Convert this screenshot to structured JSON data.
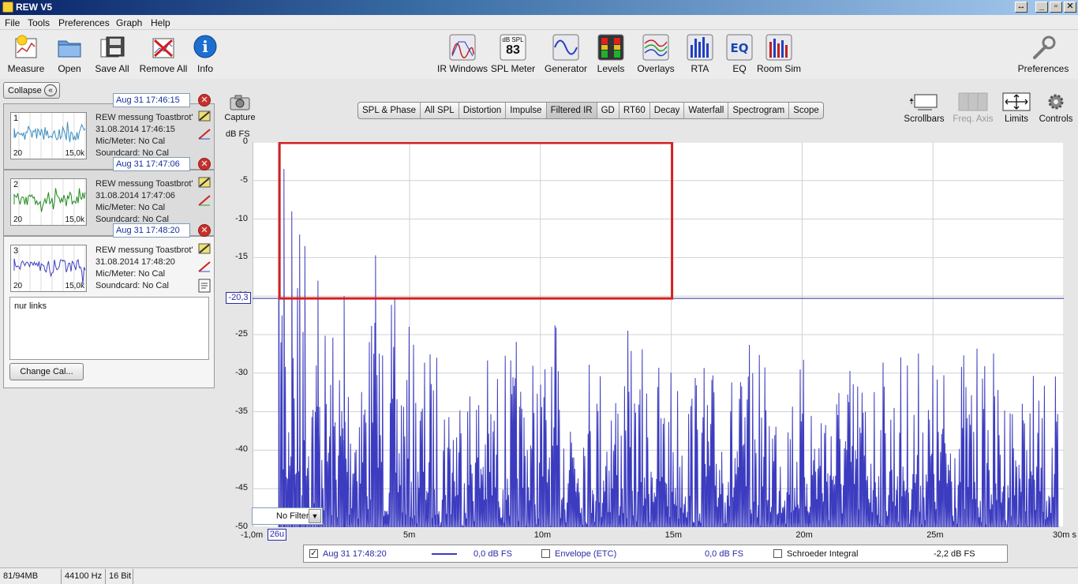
{
  "window": {
    "title": "REW V5"
  },
  "menu": [
    "File",
    "Tools",
    "Preferences",
    "Graph",
    "Help"
  ],
  "toolbar_left": [
    {
      "label": "Measure",
      "icon": "measure-icon"
    },
    {
      "label": "Open",
      "icon": "folder-icon"
    },
    {
      "label": "Save All",
      "icon": "save-icon"
    },
    {
      "label": "Remove All",
      "icon": "remove-icon"
    },
    {
      "label": "Info",
      "icon": "info-icon"
    }
  ],
  "toolbar_center": [
    {
      "label": "IR Windows",
      "icon": "ir-windows-icon"
    },
    {
      "label": "SPL Meter",
      "icon": "spl-meter-icon",
      "badge_top": "dB SPL",
      "badge_value": "83"
    },
    {
      "label": "Generator",
      "icon": "generator-icon"
    },
    {
      "label": "Levels",
      "icon": "levels-icon"
    },
    {
      "label": "Overlays",
      "icon": "overlays-icon"
    },
    {
      "label": "RTA",
      "icon": "rta-icon"
    },
    {
      "label": "EQ",
      "icon": "eq-icon"
    },
    {
      "label": "Room Sim",
      "icon": "room-sim-icon"
    }
  ],
  "toolbar_right": {
    "label": "Preferences",
    "icon": "wrench-icon"
  },
  "left_panel": {
    "collapse_label": "Collapse",
    "measurements": [
      {
        "num": "1",
        "date": "Aug 31 17:46:15",
        "name": "REW messung Toastbrot'",
        "timestamp": "31.08.2014 17:46:15",
        "mic": "Mic/Meter: No Cal",
        "soundcard": "Soundcard: No Cal",
        "range_lo": "20",
        "range_hi": "15,0k",
        "color": "#3b8fbf"
      },
      {
        "num": "2",
        "date": "Aug 31 17:47:06",
        "name": "REW messung Toastbrot'",
        "timestamp": "31.08.2014 17:47:06",
        "mic": "Mic/Meter: No Cal",
        "soundcard": "Soundcard: No Cal",
        "range_lo": "20",
        "range_hi": "15,0k",
        "color": "#1e8a1e"
      },
      {
        "num": "3",
        "date": "Aug 31 17:48:20",
        "name": "REW messung Toastbrot'",
        "timestamp": "31.08.2014 17:48:20",
        "mic": "Mic/Meter: No Cal",
        "soundcard": "Soundcard: No Cal",
        "range_lo": "20",
        "range_hi": "15,0k",
        "color": "#3f3fbf"
      }
    ],
    "notes": "nur links",
    "change_cal_label": "Change Cal..."
  },
  "graph": {
    "capture_label": "Capture",
    "tabs": [
      "SPL & Phase",
      "All SPL",
      "Distortion",
      "Impulse",
      "Filtered IR",
      "GD",
      "RT60",
      "Decay",
      "Waterfall",
      "Spectrogram",
      "Scope"
    ],
    "selected_tab": "Filtered IR",
    "right_tools": [
      {
        "label": "Scrollbars",
        "icon": "scrollbars-icon"
      },
      {
        "label": "Freq. Axis",
        "icon": "freq-axis-icon",
        "disabled": true
      },
      {
        "label": "Limits",
        "icon": "limits-icon"
      },
      {
        "label": "Controls",
        "icon": "gear-icon"
      }
    ],
    "y_unit": "dB FS",
    "y_ticks": [
      "0",
      "-5",
      "-10",
      "-15",
      "-20",
      "-25",
      "-30",
      "-35",
      "-40",
      "-45",
      "-50"
    ],
    "x_ticks": [
      "-1,0m",
      "5m",
      "10m",
      "15m",
      "20m",
      "25m",
      "30m s"
    ],
    "cursor_y_label": "-20,3",
    "cursor_x_label": "26u",
    "filter_label": "No Filter",
    "trace_color": "#3c3cc0",
    "highlight_color": "#d42020"
  },
  "chart_data": {
    "type": "line",
    "title": "",
    "xlabel": "s",
    "ylabel": "dB FS",
    "xlim": [
      -0.001,
      0.03
    ],
    "ylim": [
      -50,
      0
    ],
    "grid": true,
    "cursor": {
      "x": 2.6e-05,
      "y": -20.3
    },
    "highlight_region": {
      "x": [
        0.0,
        0.015
      ],
      "y": [
        -20.3,
        0
      ]
    },
    "series": [
      {
        "values": [
          {
            "x": 0.0,
            "y": 0
          },
          {
            "x": 0.0002,
            "y": -3.5
          },
          {
            "x": 0.0005,
            "y": -9
          },
          {
            "x": 0.0008,
            "y": -12
          },
          {
            "x": 0.001,
            "y": -13.5
          },
          {
            "x": 0.0015,
            "y": -18
          },
          {
            "x": 0.0025,
            "y": -20
          },
          {
            "x": 0.0037,
            "y": -14.7
          },
          {
            "x": 0.005,
            "y": -23
          },
          {
            "x": 0.008,
            "y": -25
          },
          {
            "x": 0.0115,
            "y": -21.5
          },
          {
            "x": 0.0135,
            "y": -24
          },
          {
            "x": 0.0165,
            "y": -26
          },
          {
            "x": 0.0225,
            "y": -24.5
          },
          {
            "x": 0.0265,
            "y": -24
          },
          {
            "x": 0.0297,
            "y": -30
          }
        ]
      }
    ]
  },
  "legend": {
    "entry_name": "Aug 31 17:48:20",
    "entry_value": "0,0 dB FS",
    "envelope_label": "Envelope (ETC)",
    "envelope_value": "0,0 dB FS",
    "schroeder_label": "Schroeder Integral",
    "schroeder_value": "-2,2 dB FS"
  },
  "status": {
    "memory": "81/94MB",
    "rate": "44100 Hz",
    "bits": "16 Bit"
  }
}
